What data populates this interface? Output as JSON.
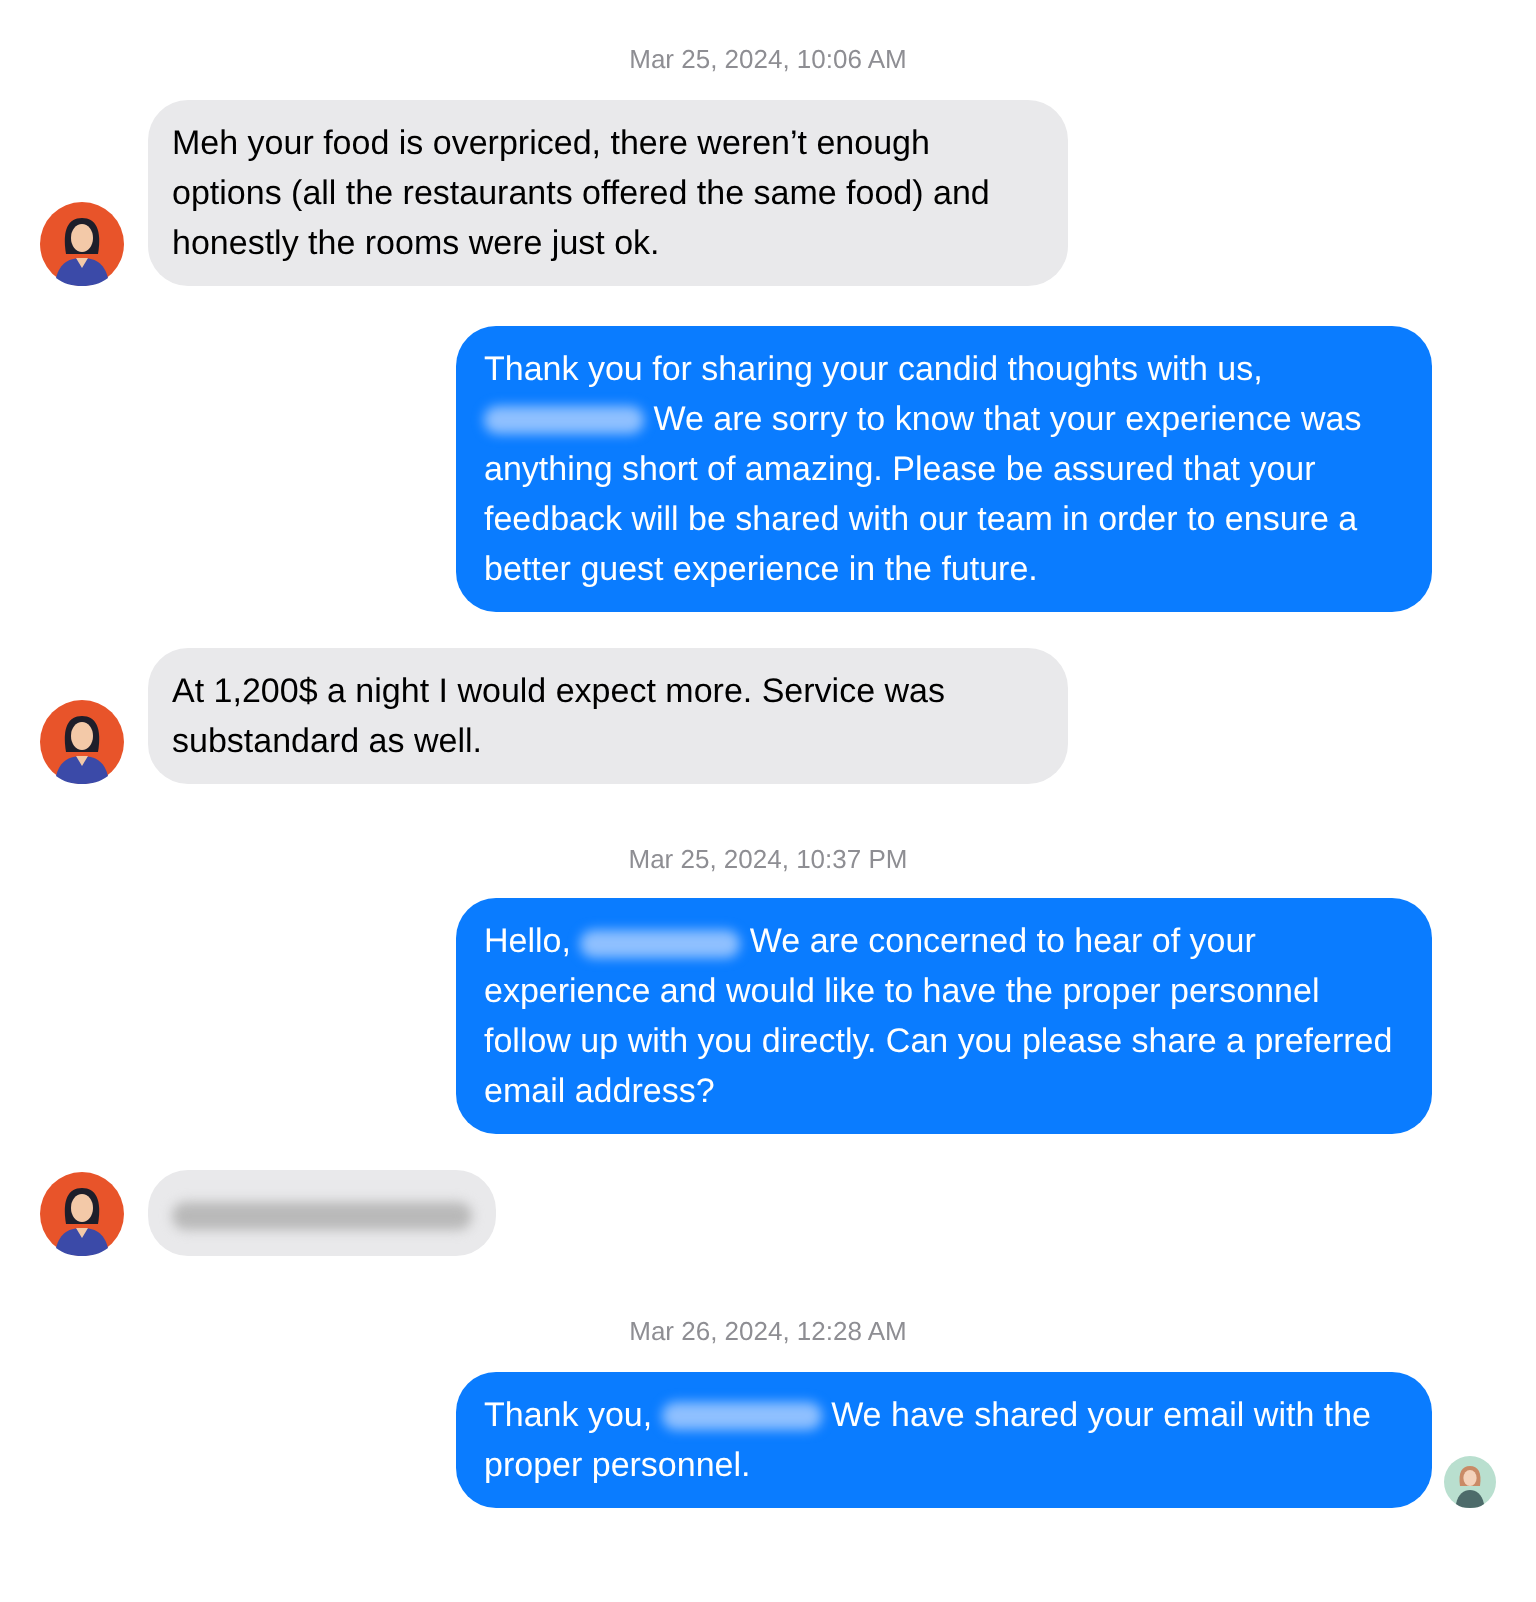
{
  "messages": [
    {
      "kind": "timestamp",
      "text": "Mar 25, 2024, 10:06 AM"
    },
    {
      "kind": "incoming",
      "avatar": true,
      "parts": [
        {
          "kind": "text",
          "text": "Meh your food is overpriced, there weren’t enough options (all the restaurants offered the same food) and honestly the rooms were just ok."
        }
      ]
    },
    {
      "kind": "outgoing",
      "avatar": false,
      "parts": [
        {
          "kind": "text",
          "text": "Thank you for sharing your candid thoughts with us,"
        },
        {
          "kind": "redacted"
        },
        {
          "kind": "text",
          "text": "We are sorry to know that your experience was anything short of amazing. Please be assured that your feedback will be shared with our team in order to ensure a better guest experience in the future."
        }
      ]
    },
    {
      "kind": "incoming",
      "avatar": true,
      "parts": [
        {
          "kind": "text",
          "text": "At 1,200$ a night I would expect more. Service was substandard as well."
        }
      ]
    },
    {
      "kind": "timestamp",
      "text": "Mar 25, 2024, 10:37 PM"
    },
    {
      "kind": "outgoing",
      "avatar": false,
      "parts": [
        {
          "kind": "text",
          "text": "Hello,"
        },
        {
          "kind": "redacted"
        },
        {
          "kind": "text",
          "text": "We are concerned to hear of your experience and would like to have the proper personnel follow up with you directly. Can you please share a preferred email address?"
        }
      ]
    },
    {
      "kind": "incoming",
      "avatar": true,
      "parts": [
        {
          "kind": "redacted"
        }
      ]
    },
    {
      "kind": "timestamp",
      "text": "Mar 26, 2024, 12:28 AM"
    },
    {
      "kind": "outgoing",
      "avatar": true,
      "parts": [
        {
          "kind": "text",
          "text": "Thank you,"
        },
        {
          "kind": "redacted"
        },
        {
          "kind": "text",
          "text": "We have shared your email with the proper personnel."
        }
      ]
    }
  ]
}
